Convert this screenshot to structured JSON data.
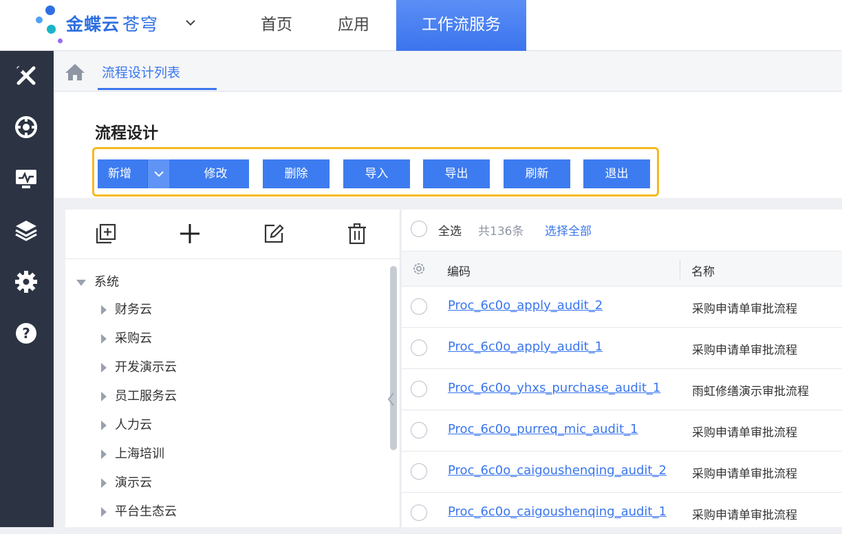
{
  "header": {
    "brand": "金蝶云",
    "brand_sub": "苍穹",
    "nav": [
      "首页",
      "应用",
      "工作流服务"
    ],
    "active_nav": "工作流服务",
    "accent_color": "#3b74ee"
  },
  "rail": {
    "icons": [
      "tools-icon",
      "target-icon",
      "monitor-icon",
      "layers-icon",
      "gear-icon",
      "help-icon"
    ]
  },
  "breadcrumb": {
    "tab": "流程设计列表"
  },
  "page": {
    "title": "流程设计"
  },
  "toolbar": {
    "buttons": [
      "新增",
      "修改",
      "删除",
      "导入",
      "导出",
      "刷新",
      "退出"
    ]
  },
  "tree": {
    "root": "系统",
    "children": [
      "财务云",
      "采购云",
      "开发演示云",
      "员工服务云",
      "人力云",
      "上海培训",
      "演示云",
      "平台生态云"
    ]
  },
  "selection": {
    "select_all": "全选",
    "count": "共136条",
    "select_all_link": "选择全部"
  },
  "table": {
    "columns": [
      "编码",
      "名称"
    ],
    "rows": [
      {
        "code": "Proc_6c0o_apply_audit_2",
        "name": "采购申请单审批流程"
      },
      {
        "code": "Proc_6c0o_apply_audit_1",
        "name": "采购申请单审批流程"
      },
      {
        "code": "Proc_6c0o_yhxs_purchase_audit_1",
        "name": "雨虹修缮演示审批流程"
      },
      {
        "code": "Proc_6c0o_purreq_mic_audit_1",
        "name": "采购申请单审批流程"
      },
      {
        "code": "Proc_6c0o_caigoushenqing_audit_2",
        "name": "采购申请单审批流程"
      },
      {
        "code": "Proc_6c0o_caigoushenqing_audit_1",
        "name": "采购申请单审批流程"
      }
    ]
  }
}
